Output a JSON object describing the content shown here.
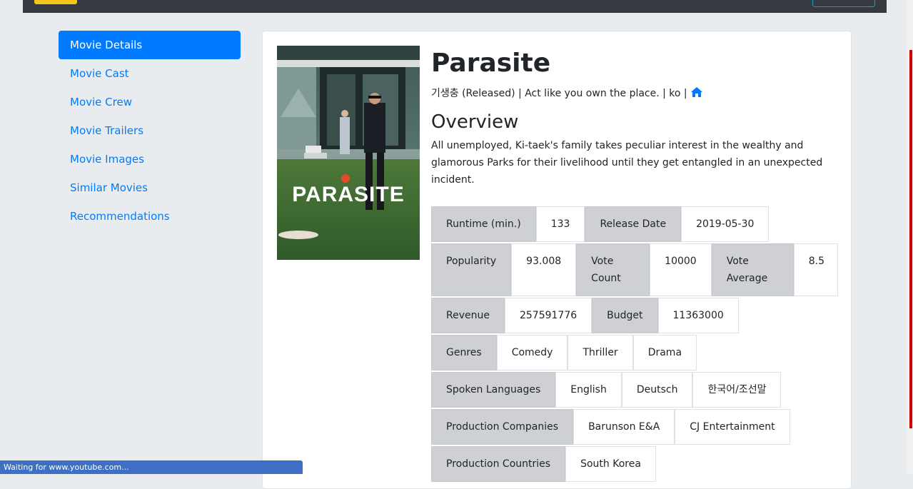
{
  "sidebar": {
    "items": [
      {
        "label": "Movie Details",
        "active": true
      },
      {
        "label": "Movie Cast"
      },
      {
        "label": "Movie Crew"
      },
      {
        "label": "Movie Trailers"
      },
      {
        "label": "Movie Images"
      },
      {
        "label": "Similar Movies"
      },
      {
        "label": "Recommendations"
      }
    ]
  },
  "movie": {
    "title": "Parasite",
    "poster_text": "PARASITE",
    "subline": "기생충 (Released) | Act like you own the place. | ko |",
    "home_icon": "home-icon",
    "overview_heading": "Overview",
    "overview": "All unemployed, Ki-taek's family takes peculiar interest in the wealthy and glamorous Parks for their livelihood until they get entangled in an unexpected incident."
  },
  "info": {
    "runtime_label": "Runtime (min.)",
    "runtime": "133",
    "release_label": "Release Date",
    "release": "2019-05-30",
    "popularity_label": "Popularity",
    "popularity": "93.008",
    "vote_count_label": "Vote Count",
    "vote_count": "10000",
    "vote_average_label": "Vote Average",
    "vote_average": "8.5",
    "revenue_label": "Revenue",
    "revenue": "257591776",
    "budget_label": "Budget",
    "budget": "11363000",
    "genres_label": "Genres",
    "genres": [
      "Comedy",
      "Thriller",
      "Drama"
    ],
    "languages_label": "Spoken Languages",
    "languages": [
      "English",
      "Deutsch",
      "한국어/조선말"
    ],
    "companies_label": "Production Companies",
    "companies": [
      "Barunson E&A",
      "CJ Entertainment"
    ],
    "countries_label": "Production Countries",
    "countries": [
      "South Korea"
    ]
  },
  "status": {
    "text": "Waiting for www.youtube.com..."
  },
  "colors": {
    "primary": "#007bff",
    "navbar": "#343a40",
    "label_bg": "#ced0d3",
    "status_bar": "#3f6fc4"
  }
}
